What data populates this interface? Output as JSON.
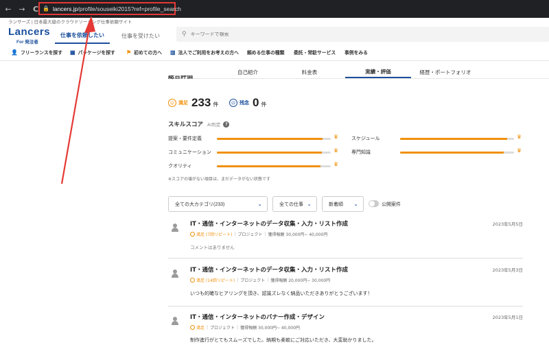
{
  "browser": {
    "back_glyph": "←",
    "forward_glyph": "→",
    "reload_glyph": "C",
    "lock_glyph": "🔒",
    "url_host": "lancers.jp",
    "url_path": "/profile/souseiki2015?ref=profile_search"
  },
  "header": {
    "tagline": "ランサーズ | 日本最大級のクラウドソーシング仕事依頼サイト",
    "logo": "Lancers",
    "logo_sub": "For 発注者",
    "tab_order": "仕事を依頼したい",
    "tab_receive": "仕事を受けたい",
    "search_placeholder": "キーワードで検索",
    "search_icon": "search-icon"
  },
  "subnav": [
    {
      "label": "フリーランスを探す",
      "icon": "person-icon",
      "glyph": "👤"
    },
    {
      "label": "パッケージを探す",
      "icon": "package-icon",
      "glyph": "▦"
    },
    {
      "label": "初めての方へ",
      "icon": "flag-icon",
      "glyph": "⚑"
    },
    {
      "label": "法人でご利用をお考えの方へ",
      "icon": "building-icon",
      "glyph": "▥"
    },
    {
      "label": "頼める仕事の種類",
      "icon": "",
      "glyph": ""
    },
    {
      "label": "委託・常駐サービス",
      "icon": "",
      "glyph": ""
    },
    {
      "label": "事例をみる",
      "icon": "",
      "glyph": ""
    }
  ],
  "profile_tabs": {
    "intro": "自己紹介",
    "price": "料金表",
    "results": "実績・評価",
    "career": "経歴・ポートフォリオ"
  },
  "rating": {
    "heading": "総合評価",
    "good_label": "満足",
    "good_count": "233",
    "bad_label": "残念",
    "bad_count": "0",
    "unit": "件",
    "good_face": "☺",
    "bad_face": "☹"
  },
  "skill": {
    "title": "スキルスコア",
    "ai": "AI判定",
    "help": "?",
    "crown": "♛",
    "note": "※スコアの値がない項目は、まだデータがない状態です",
    "left": [
      {
        "label": "提案・要件定義",
        "level": 0.93
      },
      {
        "label": "コミュニケーション",
        "level": 0.92
      },
      {
        "label": "クオリティ",
        "level": 0.91
      }
    ],
    "right": [
      {
        "label": "スケジュール",
        "level": 0.94
      },
      {
        "label": "専門知識",
        "level": 0.91
      }
    ]
  },
  "filters": {
    "category": "全ての大カテゴリ(233)",
    "work": "全ての仕事",
    "sort": "新着順",
    "public_label": "公開案件",
    "chevron": "⌄"
  },
  "items": [
    {
      "title": "IT・通信・インターネットのデータ収集・入力・リスト作成",
      "date": "2023年5月5日",
      "rating": "満足 (7回リピート)",
      "type": "プロジェクト",
      "reward": "獲得報酬 30,000円~ 40,000円",
      "comment": "コメントはありません"
    },
    {
      "title": "IT・通信・インターネットのデータ収集・入力・リスト作成",
      "date": "2023年5月3日",
      "rating": "満足 (14回リピート)",
      "type": "プロジェクト",
      "reward": "獲得報酬 20,000円~ 30,000円",
      "comment": "いつも的確なヒアリングを頂き、認識ズレなく納品いただきありがとうございます！"
    },
    {
      "title": "IT・通信・インターネットのバナー作成・デザイン",
      "date": "2023年5月1日",
      "rating": "満足",
      "type": "プロジェクト",
      "reward": "獲得報酬 30,000円~ 40,000円",
      "comment": "制作進行がとてもスムーズでした。納期も柔軟にご対応いただき、大変助かりました。"
    }
  ],
  "colors": {
    "brand": "#1a4f9c",
    "accent": "#f0900a",
    "annotation": "#e53935"
  }
}
